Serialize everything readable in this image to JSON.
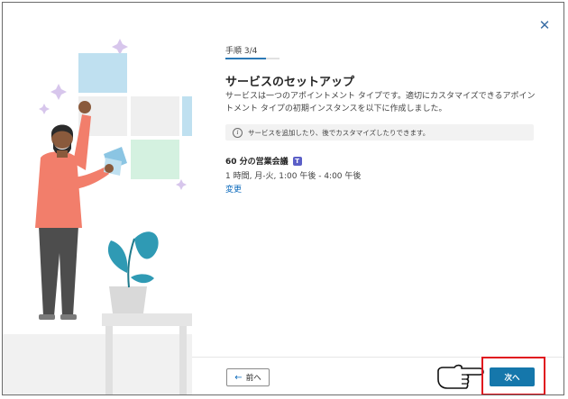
{
  "dialog": {
    "step_label": "手順 3/4",
    "progress": 0.75,
    "title": "サービスのセットアップ",
    "description": "サービスは一つのアポイントメント タイプです。適切にカスタマイズできるアポイントメント タイプの初期インスタンスを以下に作成しました。",
    "info_text": "サービスを追加したり、後でカスタマイズしたりできます。",
    "service": {
      "name": "60 分の営業会議",
      "time": "1 時間, 月-火, 1:00 午後 - 4:00 午後",
      "change_label": "変更"
    },
    "back_label": "前へ",
    "next_label": "次へ"
  },
  "icons": {
    "close": "close-icon",
    "info": "info-icon",
    "teams": "teams-icon",
    "back_arrow": "arrow-left-icon",
    "hand_pointer": "hand-pointer-icon"
  },
  "colors": {
    "accent": "#1577ab",
    "progress": "#2b79b6",
    "link": "#0f6cbd",
    "highlight": "#e0141e"
  }
}
